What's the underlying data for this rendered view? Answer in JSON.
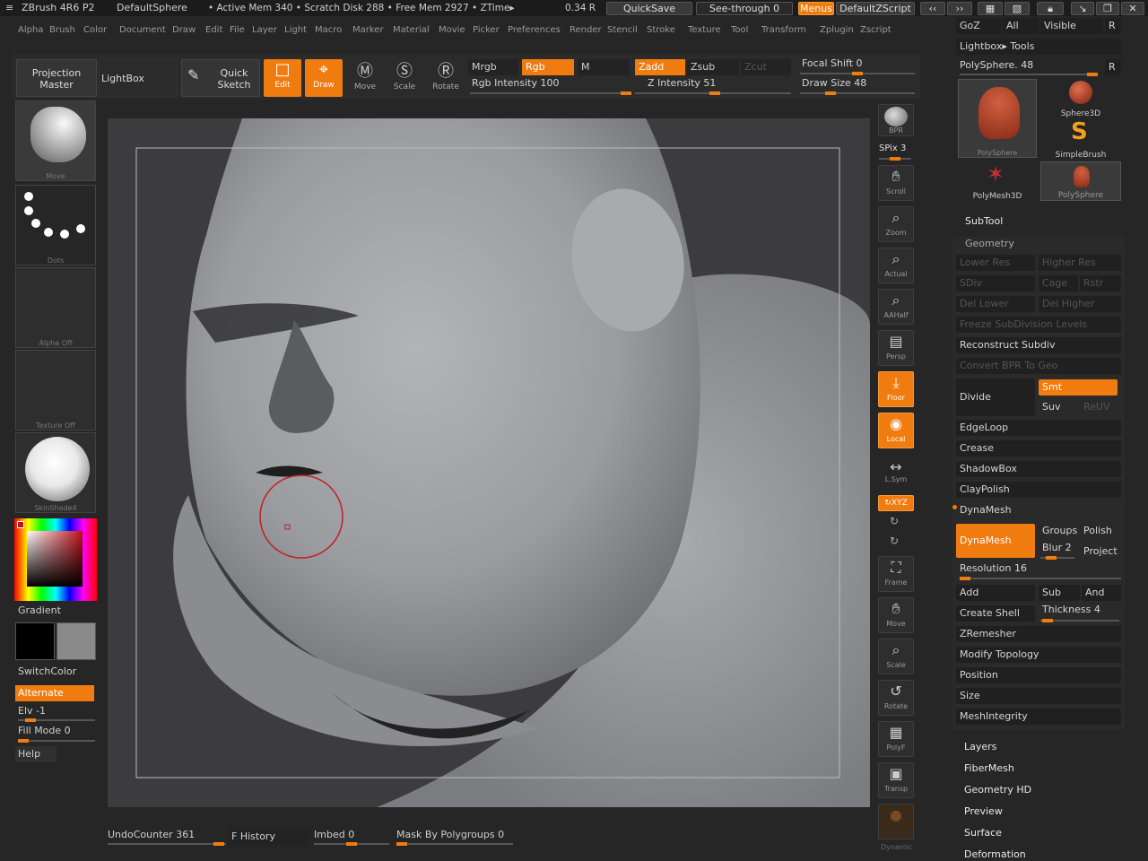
{
  "titlebar": {
    "app": "ZBrush 4R6 P2",
    "doc": "DefaultSphere",
    "mem": "• Active Mem 340 • Scratch Disk 288 • Free Mem 2927 • ZTime▸",
    "ztime_tail": "0.34 R",
    "quicksave": "QuickSave",
    "seethrough": "See-through  0",
    "menus": "Menus",
    "zscript": "DefaultZScript"
  },
  "menus": [
    "Alpha",
    "Brush",
    "Color",
    "Document",
    "Draw",
    "Edit",
    "File",
    "Layer",
    "Light",
    "Macro",
    "Marker",
    "Material",
    "Movie",
    "Picker",
    "Preferences",
    "Render",
    "Stencil",
    "Stroke",
    "Texture",
    "Tool",
    "Transform",
    "Zplugin",
    "Zscript"
  ],
  "toolbar": {
    "projection_master": "Projection Master",
    "lightbox": "LightBox",
    "quick_sketch": "Quick Sketch",
    "edit": "Edit",
    "draw": "Draw",
    "move": "Move",
    "scale": "Scale",
    "rotate": "Rotate",
    "mrgb": "Mrgb",
    "rgb": "Rgb",
    "m": "M",
    "rgb_intensity": "Rgb Intensity 100",
    "zadd": "Zadd",
    "zsub": "Zsub",
    "zcut": "Zcut",
    "z_intensity": "Z Intensity 51",
    "focal_shift": "Focal Shift 0",
    "draw_size": "Draw Size 48",
    "rgb_intensity_value": 100,
    "z_intensity_value": 51,
    "draw_size_value": 48
  },
  "left": {
    "brush": "Move",
    "stroke": "Dots",
    "alpha": "Alpha Off",
    "texture": "Texture Off",
    "material": "SkinShade4",
    "gradient": "Gradient",
    "switchcolor": "SwitchColor",
    "alternate": "Alternate",
    "elv": "Elv -1",
    "fill_mode": "Fill Mode 0",
    "help": "Help"
  },
  "right_shelf": {
    "bpr": "BPR",
    "spix": "SPix 3",
    "scroll": "Scroll",
    "zoom": "Zoom",
    "actual": "Actual",
    "aahalf": "AAHalf",
    "persp": "Persp",
    "floor": "Floor",
    "local": "Local",
    "lsym": "L.Sym",
    "xyz": "↻XYZ",
    "frame": "Frame",
    "move": "Move",
    "scale": "Scale",
    "rotate": "Rotate",
    "polyf": "PolyF",
    "transp": "Transp",
    "dynamic": "Dynamic"
  },
  "tray": {
    "goz": "GoZ",
    "all": "All",
    "visible": "Visible",
    "r": "R",
    "lightbox_tools": "Lightbox▸ Tools",
    "polysphere": "PolySphere. 48",
    "tools": [
      "PolySphere",
      "Sphere3D",
      "SimpleBrush",
      "PolyMesh3D",
      "PolySphere"
    ],
    "subtool": "SubTool",
    "geometry": "Geometry",
    "lower_res": "Lower Res",
    "higher_res": "Higher Res",
    "sdiv": "SDiv",
    "cage": "Cage",
    "rstr": "Rstr",
    "del_lower": "Del Lower",
    "del_higher": "Del Higher",
    "freeze": "Freeze SubDivision Levels",
    "reconstruct": "Reconstruct Subdiv",
    "convert_bpr": "Convert BPR To Geo",
    "divide": "Divide",
    "smt": "Smt",
    "suv": "Suv",
    "reuv": "ReUV",
    "edgeloop": "EdgeLoop",
    "crease": "Crease",
    "shadowbox": "ShadowBox",
    "claypolish": "ClayPolish",
    "dynamesh_hdr": "DynaMesh",
    "dynamesh_btn": "DynaMesh",
    "groups": "Groups",
    "polish": "Polish",
    "blur": "Blur 2",
    "project": "Project",
    "resolution": "Resolution 16",
    "add": "Add",
    "sub": "Sub",
    "and": "And",
    "create_shell": "Create Shell",
    "thickness": "Thickness 4",
    "zremesher": "ZRemesher",
    "modify_topology": "Modify Topology",
    "position": "Position",
    "size": "Size",
    "meshintegrity": "MeshIntegrity",
    "layers": "Layers",
    "fibermesh": "FiberMesh",
    "geometry_hd": "Geometry HD",
    "preview": "Preview",
    "surface": "Surface",
    "deformation": "Deformation"
  },
  "bottom": {
    "undo": "UndoCounter 361",
    "history": "F History",
    "imbed": "Imbed 0",
    "mask_polygroups": "Mask By Polygroups 0"
  },
  "colors": {
    "accent": "#f07c10",
    "panel": "#2b2b2b",
    "bg": "#262626"
  }
}
